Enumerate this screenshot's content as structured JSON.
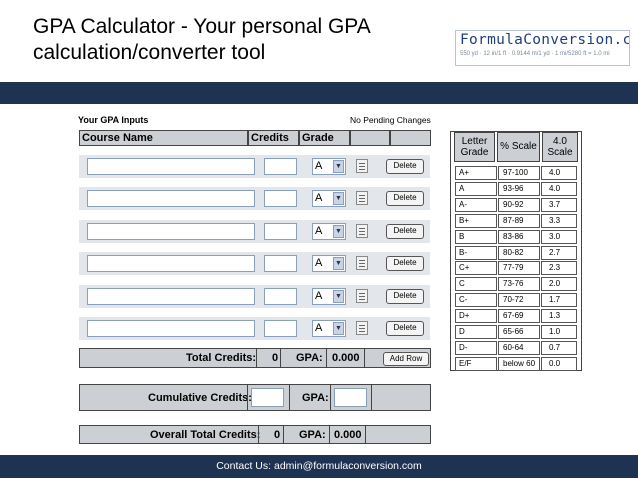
{
  "header": {
    "title": "GPA Calculator - Your personal GPA calculation/converter tool",
    "logo_name": "FormulaConversion.com",
    "logo_formula": "550 yd · 12 in/1 ft · 0.9144 m/1 yd · 1 mi/5280 ft = 1.0 mi",
    "colors": {
      "band": "#1e3252",
      "panel": "#ccd0d4",
      "row": "#e3e6ea"
    }
  },
  "inputs": {
    "title": "Your GPA Inputs",
    "status": "No Pending Changes",
    "columns": {
      "course": "Course Name",
      "credits": "Credits",
      "grade": "Grade"
    },
    "delete_label": "Delete",
    "rows": [
      {
        "course": "",
        "credits": "",
        "grade": "A"
      },
      {
        "course": "",
        "credits": "",
        "grade": "A"
      },
      {
        "course": "",
        "credits": "",
        "grade": "A"
      },
      {
        "course": "",
        "credits": "",
        "grade": "A"
      },
      {
        "course": "",
        "credits": "",
        "grade": "A"
      },
      {
        "course": "",
        "credits": "",
        "grade": "A"
      }
    ]
  },
  "totals": {
    "total_credits_label": "Total Credits:",
    "total_credits_value": "0",
    "gpa_label": "GPA:",
    "gpa_value": "0.000",
    "add_row_label": "Add Row"
  },
  "cumulative": {
    "credits_label": "Cumulative Credits:",
    "credits_value": "",
    "gpa_label": "GPA:",
    "gpa_value": ""
  },
  "overall": {
    "credits_label": "Overall Total Credits:",
    "credits_value": "0",
    "gpa_label": "GPA:",
    "gpa_value": "0.000"
  },
  "grade_table": {
    "headers": {
      "letter": "Letter Grade",
      "percent": "% Scale",
      "scale": "4.0 Scale"
    },
    "rows": [
      {
        "letter": "A+",
        "percent": "97-100",
        "scale": "4.0"
      },
      {
        "letter": "A",
        "percent": "93-96",
        "scale": "4.0"
      },
      {
        "letter": "A-",
        "percent": "90-92",
        "scale": "3.7"
      },
      {
        "letter": "B+",
        "percent": "87-89",
        "scale": "3.3"
      },
      {
        "letter": "B",
        "percent": "83-86",
        "scale": "3.0"
      },
      {
        "letter": "B-",
        "percent": "80-82",
        "scale": "2.7"
      },
      {
        "letter": "C+",
        "percent": "77-79",
        "scale": "2.3"
      },
      {
        "letter": "C",
        "percent": "73-76",
        "scale": "2.0"
      },
      {
        "letter": "C-",
        "percent": "70-72",
        "scale": "1.7"
      },
      {
        "letter": "D+",
        "percent": "67-69",
        "scale": "1.3"
      },
      {
        "letter": "D",
        "percent": "65-66",
        "scale": "1.0"
      },
      {
        "letter": "D-",
        "percent": "60-64",
        "scale": "0.7"
      },
      {
        "letter": "E/F",
        "percent": "below 60",
        "scale": "0.0"
      }
    ]
  },
  "footer": {
    "contact": "Contact Us: admin@formulaconversion.com"
  }
}
